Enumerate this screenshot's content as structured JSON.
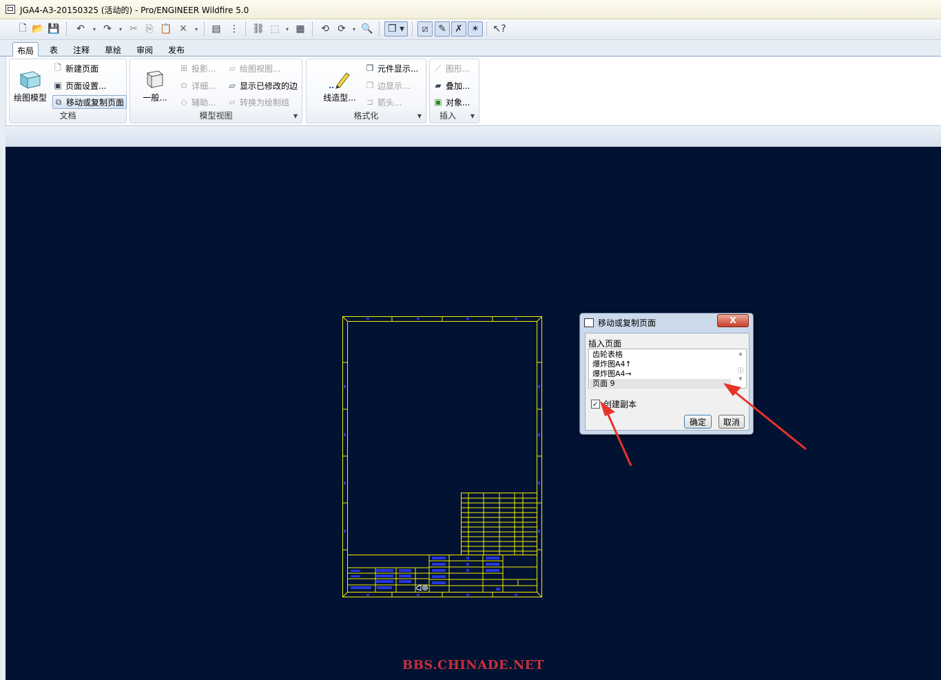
{
  "window": {
    "title": "JGA4-A3-20150325 (活动的) - Pro/ENGINEER Wildfire 5.0"
  },
  "quick_toolbar": {
    "icons": [
      "new-icon",
      "open-icon",
      "save-icon",
      "undo-icon",
      "redo-icon",
      "cut-icon",
      "copy-icon",
      "paste-icon",
      "delete-icon",
      "layers-icon",
      "model-tree-icon",
      "binoculars-icon",
      "select-box-icon",
      "properties-icon",
      "regenerate-icon",
      "repaint-icon",
      "zoom-icon",
      "display-style-icon",
      "datum-plane-icon",
      "datum-axis-icon",
      "datum-point-icon",
      "datum-csys-icon",
      "context-help-icon"
    ]
  },
  "tabs": [
    "布局",
    "表",
    "注释",
    "草绘",
    "审阅",
    "发布"
  ],
  "active_tab": "布局",
  "ribbon": {
    "document": {
      "label": "文档",
      "big_button": "绘图模型",
      "items": [
        "新建页面",
        "页面设置...",
        "移动或复制页面"
      ]
    },
    "model_views": {
      "label": "模型视图",
      "big_button": "一般...",
      "items": [
        "投影...",
        "详细...",
        "辅助...",
        "绘图视图...",
        "显示已修改的边",
        "转换为绘制组"
      ]
    },
    "format": {
      "label": "格式化",
      "big_button": "线造型...",
      "items": [
        "元件显示...",
        "边显示...",
        "箭头..."
      ]
    },
    "insert": {
      "label": "插入",
      "items": [
        "图形...",
        "叠加...",
        "对象..."
      ]
    }
  },
  "dialog": {
    "title": "移动或复制页面",
    "close": "X",
    "insert_label": "插入页面",
    "pages": [
      "齿轮表格",
      "爆炸图A4↑",
      "爆炸图A4→",
      "页面 9"
    ],
    "selected_page": "页面 9",
    "create_copy_label": "创建副本",
    "create_copy_checked": true,
    "ok": "确定",
    "cancel": "取消"
  },
  "colors": {
    "canvas": "#021233",
    "drawing_line": "#f0f000",
    "annotation_arrow": "#e8332a",
    "watermark": "#c8303a"
  },
  "watermark": "BBS.CHINADE.NET"
}
